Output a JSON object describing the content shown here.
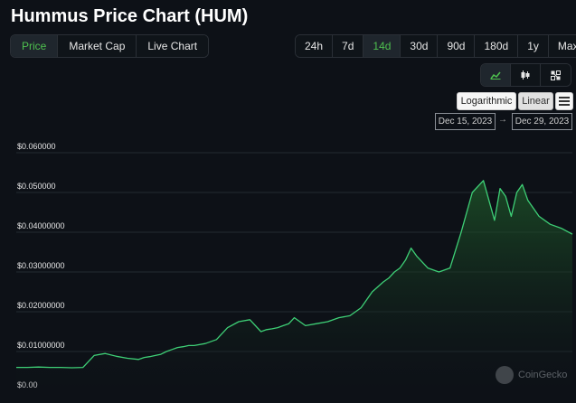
{
  "page_title": "Hummus Price Chart (HUM)",
  "type_tabs": [
    {
      "label": "Price",
      "active": true
    },
    {
      "label": "Market Cap",
      "active": false
    },
    {
      "label": "Live Chart",
      "active": false
    }
  ],
  "range_tabs": [
    {
      "label": "24h",
      "active": false
    },
    {
      "label": "7d",
      "active": false
    },
    {
      "label": "14d",
      "active": true
    },
    {
      "label": "30d",
      "active": false
    },
    {
      "label": "90d",
      "active": false
    },
    {
      "label": "180d",
      "active": false
    },
    {
      "label": "1y",
      "active": false
    },
    {
      "label": "Max",
      "active": false
    }
  ],
  "view_toggle": [
    {
      "icon": "line-chart-icon",
      "active": true
    },
    {
      "icon": "candlestick-icon",
      "active": false
    },
    {
      "icon": "expand-icon",
      "active": false
    }
  ],
  "scale": {
    "log_label": "Logarithmic",
    "linear_label": "Linear",
    "menu_icon": "hamburger-menu-icon"
  },
  "date_range": {
    "from": "Dec 15, 2023",
    "arrow": "→",
    "to": "Dec 29, 2023"
  },
  "watermark": "CoinGecko",
  "colors": {
    "accent": "#4ec04e",
    "line": "#3ecf76",
    "background": "#0d1117"
  },
  "chart_data": {
    "type": "area",
    "y_tick_labels": [
      "$0.00",
      "$0.01000000",
      "$0.02000000",
      "$0.03000000",
      "$0.04000000",
      "$0.050000",
      "$0.060000"
    ],
    "y_ticks": [
      0,
      0.01,
      0.02,
      0.03,
      0.04,
      0.05,
      0.06
    ],
    "ylim": [
      0,
      0.06
    ],
    "grid": true,
    "series": [
      {
        "x": [
          0,
          2,
          4,
          6,
          8,
          10,
          12,
          14,
          16,
          18,
          20,
          22,
          23,
          24,
          25,
          26,
          27,
          28,
          29,
          30,
          31,
          32,
          34,
          36,
          38,
          40,
          42,
          44,
          45,
          46,
          47,
          48,
          49,
          50,
          52,
          54,
          56,
          58,
          60,
          62,
          64,
          66,
          67,
          68,
          69,
          70,
          71,
          72,
          74,
          76,
          78,
          80,
          82,
          84,
          86,
          87,
          88,
          89,
          90,
          91,
          92,
          94,
          96,
          98,
          100
        ],
        "y": [
          0.006,
          0.006,
          0.0061,
          0.006,
          0.006,
          0.0059,
          0.006,
          0.009,
          0.0095,
          0.0088,
          0.0083,
          0.008,
          0.0085,
          0.0087,
          0.009,
          0.0093,
          0.01,
          0.0105,
          0.011,
          0.0112,
          0.0115,
          0.0115,
          0.012,
          0.013,
          0.016,
          0.0175,
          0.018,
          0.015,
          0.0155,
          0.0157,
          0.016,
          0.0165,
          0.017,
          0.0185,
          0.0165,
          0.017,
          0.0175,
          0.0185,
          0.019,
          0.021,
          0.025,
          0.0275,
          0.0285,
          0.03,
          0.031,
          0.033,
          0.036,
          0.034,
          0.031,
          0.03,
          0.031,
          0.04,
          0.05,
          0.053,
          0.043,
          0.051,
          0.049,
          0.044,
          0.05,
          0.052,
          0.048,
          0.044,
          0.042,
          0.041,
          0.0395
        ]
      }
    ]
  }
}
